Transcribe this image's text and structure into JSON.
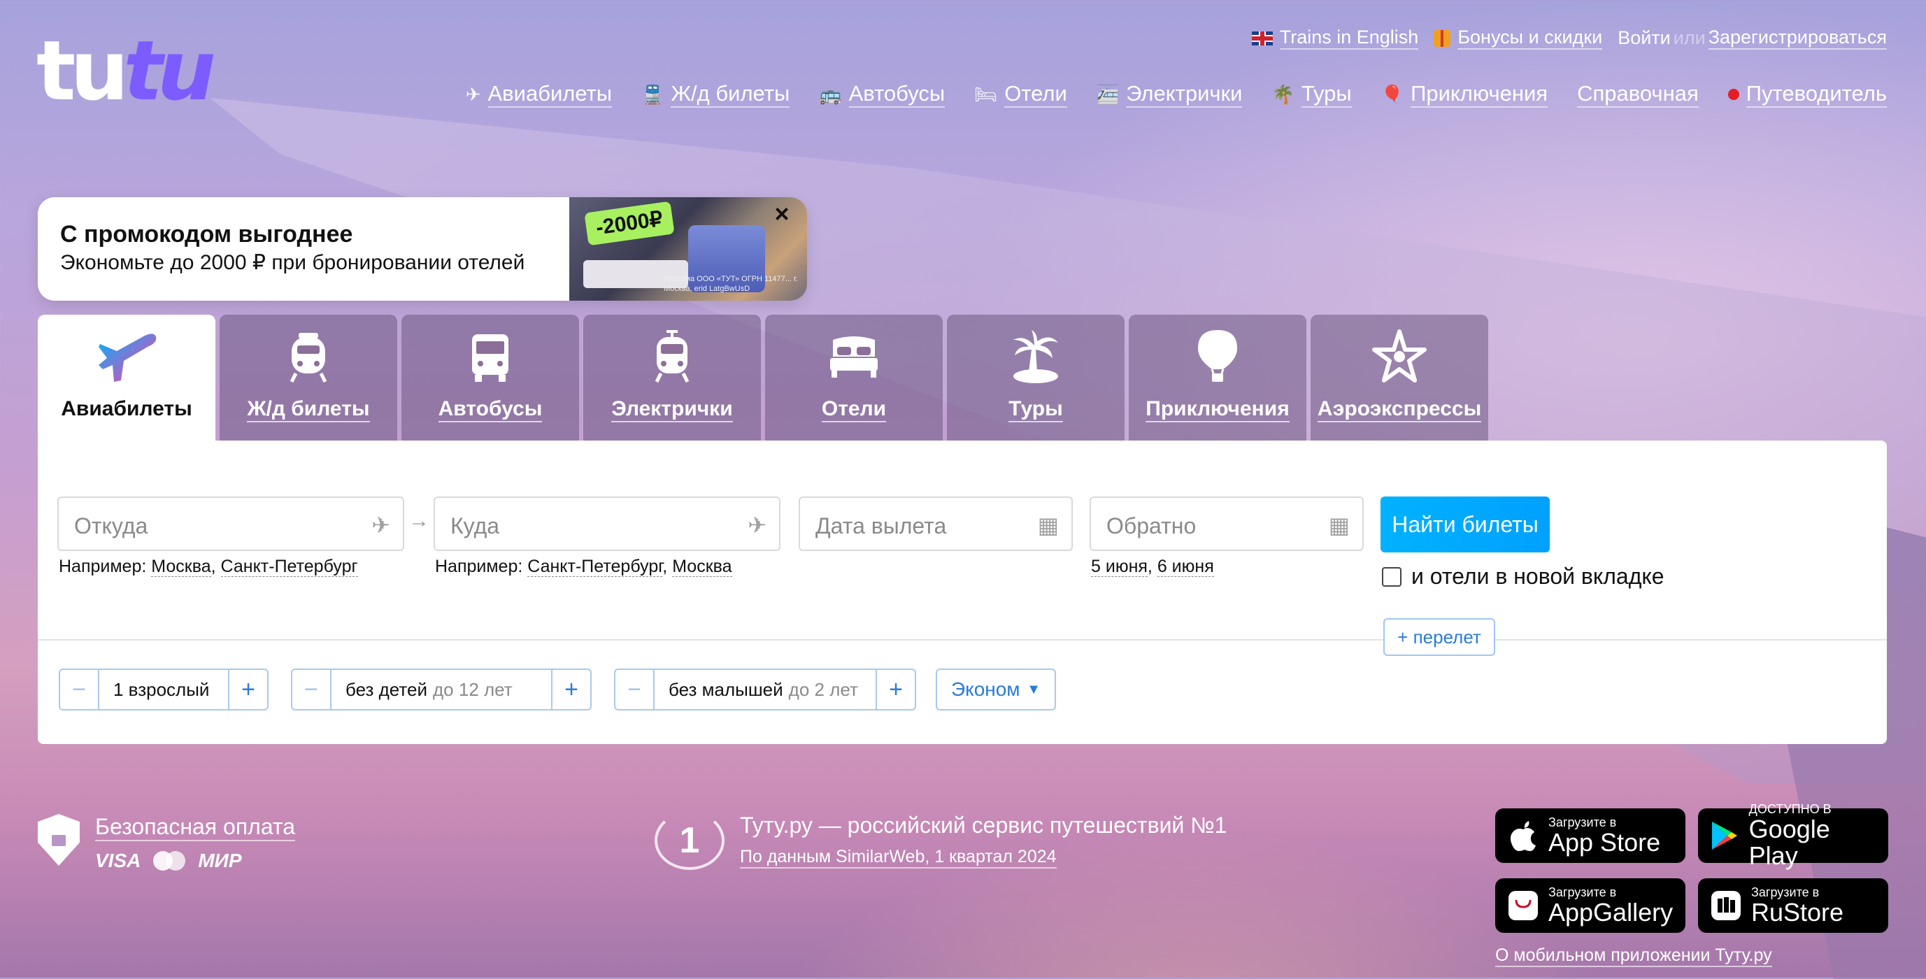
{
  "logo": {
    "part1": "tu",
    "part2": "tu"
  },
  "topbar": {
    "trains_english": "Trains in English",
    "bonuses": "Бонусы и скидки",
    "login": "Войти",
    "or": "или",
    "register": "Зарегистрироваться"
  },
  "nav": [
    {
      "label": "Авиабилеты",
      "icon": "plane-icon"
    },
    {
      "label": "Ж/д билеты",
      "icon": "train-icon"
    },
    {
      "label": "Автобусы",
      "icon": "bus-icon"
    },
    {
      "label": "Отели",
      "icon": "bed-icon"
    },
    {
      "label": "Электрички",
      "icon": "commuter-train-icon"
    },
    {
      "label": "Туры",
      "icon": "palm-icon"
    },
    {
      "label": "Приключения",
      "icon": "balloon-icon"
    },
    {
      "label": "Справочная",
      "icon": ""
    },
    {
      "label": "Путеводитель",
      "icon": "red-dot-icon"
    }
  ],
  "promo": {
    "title": "С промокодом выгоднее",
    "text": "Экономьте до 2000 ₽ при бронировании отелей",
    "badge": "-2000₽",
    "legal": "Реклама ООО «ТУТ» ОГРН 11477... г. Москва, erid LatgBwUsD"
  },
  "tabs": [
    {
      "label": "Авиабилеты",
      "icon": "plane-icon",
      "active": true
    },
    {
      "label": "Ж/д билеты",
      "icon": "train-icon",
      "active": false
    },
    {
      "label": "Автобусы",
      "icon": "bus-icon",
      "active": false
    },
    {
      "label": "Электрички",
      "icon": "commuter-train-icon",
      "active": false
    },
    {
      "label": "Отели",
      "icon": "bed-icon",
      "active": false
    },
    {
      "label": "Туры",
      "icon": "palm-icon",
      "active": false
    },
    {
      "label": "Приключения",
      "icon": "balloon-icon",
      "active": false
    },
    {
      "label": "Аэроэкспрессы",
      "icon": "aeroexpress-icon",
      "active": false
    }
  ],
  "search": {
    "from_placeholder": "Откуда",
    "to_placeholder": "Куда",
    "depart_placeholder": "Дата вылета",
    "return_placeholder": "Обратно",
    "from_hint_prefix": "Например:",
    "from_hint_1": "Москва",
    "from_hint_2": "Санкт-Петербург",
    "to_hint_prefix": "Например:",
    "to_hint_1": "Санкт-Петербург",
    "to_hint_2": "Москва",
    "date_hint_1": "5 июня",
    "date_hint_2": "6 июня",
    "find_button": "Найти билеты",
    "hotels_checkbox": "и отели в новой вкладке",
    "add_flight": "+ перелет",
    "adults": "1 взрослый",
    "children": "без детей",
    "children_age": "до 12 лет",
    "infants": "без малышей",
    "infants_age": "до 2 лет",
    "class": "Эконом"
  },
  "footer": {
    "secure_payment": "Безопасная оплата",
    "visa": "VISA",
    "mir": "МИР",
    "award_num": "1",
    "award_title": "Туту.ру — российский сервис путешествий №1",
    "award_source": "По данным SimilarWeb, 1 квартал 2024",
    "stores": [
      {
        "small": "Загрузите в",
        "large": "App Store",
        "icon": "apple-icon"
      },
      {
        "small": "ДОСТУПНО В",
        "large": "Google Play",
        "icon": "google-play-icon"
      },
      {
        "small": "Загрузите в",
        "large": "AppGallery",
        "icon": "huawei-icon"
      },
      {
        "small": "Загрузите в",
        "large": "RuStore",
        "icon": "rustore-icon"
      }
    ],
    "about_app": "О мобильном приложении Туту.ру"
  },
  "colors": {
    "accent": "#00b2ff",
    "brand_purple": "#7c5cff",
    "link_blue": "#2a7bd9"
  }
}
